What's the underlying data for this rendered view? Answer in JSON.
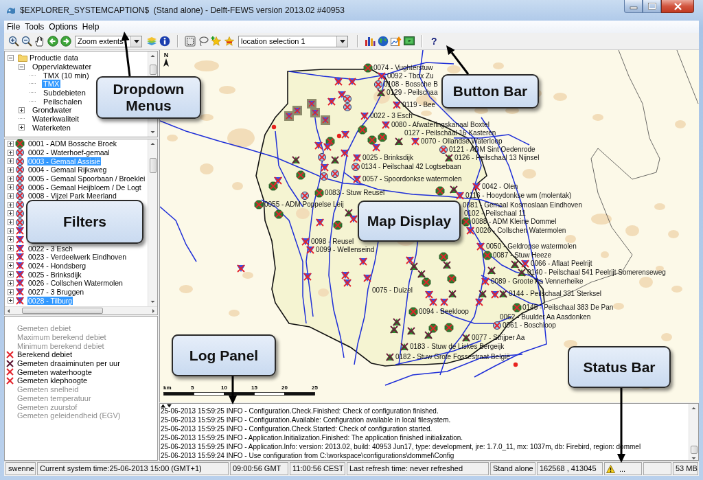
{
  "window": {
    "title": "$EXPLORER_SYSTEMCAPTION$  (Stand alone) - Delft-FEWS version 2013.02 #40953"
  },
  "menu": [
    "File",
    "Tools",
    "Options",
    "Help"
  ],
  "toolbar": {
    "zoom_dropdown": {
      "value": "Zoom extents"
    },
    "location_dropdown": {
      "value": "location selection 1"
    },
    "help_button": "?"
  },
  "tree": [
    {
      "label": "Productie data",
      "expanded": true,
      "selected": false,
      "children": [
        {
          "label": "Oppervlaktewater",
          "expanded": true,
          "selected": false,
          "children": [
            {
              "label": "TMX (10 min)",
              "selected": false
            },
            {
              "label": "TMX",
              "selected": true
            },
            {
              "label": "Subdebieten",
              "selected": false
            },
            {
              "label": "Peilschalen",
              "selected": false
            }
          ]
        },
        {
          "label": "Grondwater",
          "expanded": false,
          "selected": false
        },
        {
          "label": "Waterkwaliteit",
          "selected": false
        },
        {
          "label": "Waterketen",
          "expanded": false,
          "selected": false
        }
      ]
    }
  ],
  "filters": [
    {
      "label": "0001 - ADM Bossche Broek",
      "kind": "octagon",
      "expanded": false,
      "selected": false
    },
    {
      "label": "0002 - Waterhoef-gemaal",
      "kind": "circle",
      "expanded": false,
      "selected": false
    },
    {
      "label": "0003 - Gemaal Assisië",
      "kind": "circle",
      "expanded": false,
      "selected": true
    },
    {
      "label": "0004 - Gemaal Rijksweg",
      "kind": "circle",
      "expanded": false,
      "selected": false
    },
    {
      "label": "0005 - Gemaal Spoorbaan / Broeklei",
      "kind": "circle",
      "expanded": false,
      "selected": false
    },
    {
      "label": "0006 - Gemaal Heijbloem / De Logt",
      "kind": "circle",
      "expanded": false,
      "selected": false
    },
    {
      "label": "0008 - Vijzel Park Meerland",
      "kind": "circle",
      "expanded": false,
      "selected": false
    },
    {
      "kind": "circle",
      "expanded": false
    },
    {
      "kind": "circle",
      "expanded": false
    },
    {
      "kind": "circle",
      "expanded": false
    },
    {
      "kind": "triangle",
      "expanded": false
    },
    {
      "kind": "triangle",
      "expanded": false
    },
    {
      "label": "0022 - 3 Esch",
      "kind": "triangle",
      "expanded": false,
      "selected": false
    },
    {
      "label": "0023 - Verdeelwerk Eindhoven",
      "kind": "triangle",
      "expanded": false,
      "selected": false
    },
    {
      "label": "0024 - Hondsberg",
      "kind": "triangle",
      "expanded": false,
      "selected": false
    },
    {
      "label": "0025 - Brinksdijk",
      "kind": "triangle",
      "expanded": false,
      "selected": false
    },
    {
      "label": "0026 - Collschen Watermolen",
      "kind": "triangle",
      "expanded": false,
      "selected": false
    },
    {
      "label": "0027 - 3 Bruggen",
      "kind": "triangle",
      "expanded": false,
      "selected": false
    },
    {
      "label": "0028 - Tilburg",
      "kind": "triangle",
      "expanded": false,
      "selected": true
    }
  ],
  "parameters": [
    {
      "label": "Gemeten debiet",
      "available": false
    },
    {
      "label": "Maximum berekend debiet",
      "available": false
    },
    {
      "label": "Minimum berekend debiet",
      "available": false
    },
    {
      "label": "Berekend debiet",
      "available": true,
      "color": "#e3232b"
    },
    {
      "label": "Gemeten draaiminuten per uur",
      "available": true,
      "color": "#5b1432"
    },
    {
      "label": "Gemeten waterhoogte",
      "available": true,
      "color": "#e3232b"
    },
    {
      "label": "Gemeten klephoogte",
      "available": true,
      "color": "#e3232b"
    },
    {
      "label": "Gemeten snelheid",
      "available": false
    },
    {
      "label": "Gemeten temperatuur",
      "available": false
    },
    {
      "label": "Gemeten zuurstof",
      "available": false
    },
    {
      "label": "Gemeten geleidendheid (EGV)",
      "available": false
    }
  ],
  "map": {
    "north_label": "N",
    "stations": [
      {
        "label": "0074 - Vughterstuw",
        "kind": "octagon"
      },
      {
        "label": "0092 - Tbox Zu",
        "kind": "triangle"
      },
      {
        "label": "0108 - Bossche B",
        "kind": "circle"
      },
      {
        "label": "0129 - Peilschaa",
        "kind": "greenup"
      },
      {
        "label": "0119 - Bee",
        "kind": "triangle"
      },
      {
        "label": "0022 - 3 Esch",
        "kind": "triangle"
      },
      {
        "label": "0080 - Afwateringskanaal Boxtel",
        "kind": "triangle"
      },
      {
        "label": "0127 - Peilschaal 16 Kasteren"
      },
      {
        "label": "0070 - Ollandse Waterloop",
        "kind": "triangle"
      },
      {
        "label": "0121 - ADM Sint Oedenrode",
        "kind": "circle"
      },
      {
        "label": "0025 - Brinksdijk",
        "kind": "triangle"
      },
      {
        "label": "0126 - Peilschaal 13 Nijnsel",
        "kind": "greenup"
      },
      {
        "label": "0134 - Peilschaal 42 Logtsebaan",
        "kind": "circle"
      },
      {
        "label": "0057 - Spoordonkse watermolen",
        "kind": "triangle"
      },
      {
        "label": "0083 - Stuw Reusel",
        "kind": "octagon"
      },
      {
        "label": "0042 - Olen",
        "kind": "triangle"
      },
      {
        "label": "0116 - Hooydonkse wm (molentak)",
        "kind": "triangle"
      },
      {
        "label": "0055 - ADM Poppelse Leij",
        "kind": "octagon"
      },
      {
        "label": "0081 - Gemaal Kosmoslaan Eindhoven"
      },
      {
        "label": "0102 - Peilschaal 11"
      },
      {
        "label": "0088 - ADM Kleine Dommel",
        "kind": "octagon"
      },
      {
        "label": "0026 - Collschen Watermolen",
        "kind": "triangle"
      },
      {
        "label": "0098 - Reusel",
        "kind": "triangle"
      },
      {
        "label": "0099 - Wellenseind",
        "kind": "triangle"
      },
      {
        "label": "0050 - Geldropse watermolen",
        "kind": "triangle"
      },
      {
        "label": "0087 - Stuw Heeze",
        "kind": "octagon"
      },
      {
        "label": "0066 - Aflaat Peelrijt",
        "kind": "triangle"
      },
      {
        "label": "0140 - Peilschaal 541 Peelrijt Somerenseweg",
        "kind": "greenup"
      },
      {
        "label": "0089 - Groote Aa Vennerheike",
        "kind": "triangle"
      },
      {
        "label": "0075 - Duizel"
      },
      {
        "label": "0144 - Peilschaal 331 Sterksel",
        "kind": "greenup"
      },
      {
        "label": "0094 - Beekloop",
        "kind": "octagon"
      },
      {
        "label": "0145 - Peilschaal 383 De Pan",
        "kind": "octagon"
      },
      {
        "label": "0062 - Buulder Aa Aasdonken"
      },
      {
        "label": "0061 - Boschloop",
        "kind": "circle"
      },
      {
        "label": "0077 - Strijper Aa",
        "kind": "greenup"
      },
      {
        "label": "0183 - Stuw de Liskes Bergeijk",
        "kind": "greenup"
      },
      {
        "label": "0182 - Stuw Grote Fossestraat België",
        "kind": "greenup"
      }
    ],
    "scale_bar": {
      "unit": "km",
      "ticks": [
        "5",
        "10",
        "15",
        "20",
        "25"
      ]
    }
  },
  "log": {
    "lines": [
      "25-06-2013 15:59:25 INFO - Configuration.Check.Finished: Check of configuration finished.",
      "25-06-2013 15:59:25 INFO - Configuration.Available: Configuration available in local filesystem.",
      "25-06-2013 15:59:25 INFO - Configuration.Check.Started: Check of configuration started.",
      "25-06-2013 15:59:25 INFO - Application.Initialization.Finished: The application finished initialization.",
      "25-06-2013 15:59:25 INFO - Application.Info: version: 2013.02, build: 40953 Jun17, type: development, jre: 1.7.0_11, mx: 1037m, db: Firebird, region: dommel",
      "25-06-2013 15:59:24 INFO - Use configuration from C:\\workspace\\configurations\\dommel\\Config"
    ]
  },
  "status_bar": {
    "user": "swenne",
    "system_time": "Current system time:25-06-2013 15:00 (GMT+1)",
    "gmt_time": "09:00:56 GMT",
    "local_time": "11:00:56 CEST",
    "refresh": "Last refresh time: never refreshed",
    "mode": "Stand alone",
    "coordinates": "162568 , 413045",
    "warning": "...",
    "memory": "53 MB"
  },
  "callouts": [
    {
      "text": "Dropdown Menus"
    },
    {
      "text": "Button Bar"
    },
    {
      "text": "Filters"
    },
    {
      "text": "Map Display"
    },
    {
      "text": "Log Panel"
    },
    {
      "text": "Status Bar"
    }
  ]
}
